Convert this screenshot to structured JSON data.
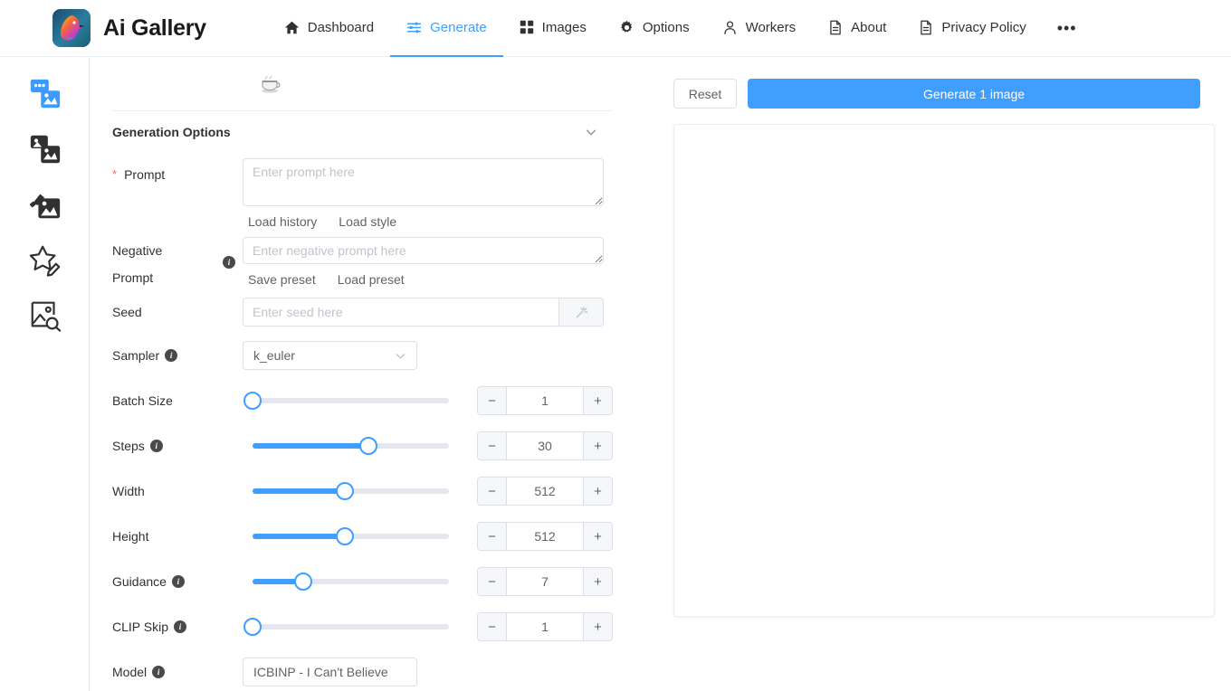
{
  "header": {
    "brand": "Ai Gallery",
    "logo_icon": "bird-logo",
    "nav": [
      {
        "label": "Dashboard",
        "icon": "home-icon",
        "active": false
      },
      {
        "label": "Generate",
        "icon": "sliders-icon",
        "active": true
      },
      {
        "label": "Images",
        "icon": "grid-icon",
        "active": false
      },
      {
        "label": "Options",
        "icon": "gear-icon",
        "active": false
      },
      {
        "label": "Workers",
        "icon": "user-icon",
        "active": false
      },
      {
        "label": "About",
        "icon": "document-icon",
        "active": false
      },
      {
        "label": "Privacy Policy",
        "icon": "document-icon",
        "active": false
      }
    ],
    "more_label": "•••"
  },
  "sidebar": {
    "items": [
      {
        "name": "text-to-image",
        "icon": "chat-image-icon",
        "active": true
      },
      {
        "name": "image-to-image",
        "icon": "images-icon",
        "active": false
      },
      {
        "name": "inpainting",
        "icon": "brush-image-icon",
        "active": false
      },
      {
        "name": "rating",
        "icon": "star-pencil-icon",
        "active": false
      },
      {
        "name": "interrogate",
        "icon": "image-search-icon",
        "active": false
      }
    ]
  },
  "form": {
    "coffee_icon": "coffee-cup-icon",
    "section_title": "Generation Options",
    "collapse_icon": "chevron-down-icon",
    "prompt": {
      "label": "Prompt",
      "required_marker": "*",
      "value": "",
      "placeholder": "Enter prompt here",
      "links": [
        "Load history",
        "Load style"
      ]
    },
    "negative_prompt": {
      "label_line1": "Negative",
      "label_line2": "Prompt",
      "info_icon": "info-icon",
      "value": "",
      "placeholder": "Enter negative prompt here",
      "links": [
        "Save preset",
        "Load preset"
      ]
    },
    "seed": {
      "label": "Seed",
      "value": "",
      "placeholder": "Enter seed here",
      "random_icon": "magic-wand-icon"
    },
    "sampler": {
      "label": "Sampler",
      "info_icon": "info-icon",
      "value": "k_euler",
      "chevron": "chevron-down-icon"
    },
    "sliders": [
      {
        "label": "Batch Size",
        "info": false,
        "value": "1",
        "percent": 0
      },
      {
        "label": "Steps",
        "info": true,
        "value": "30",
        "percent": 59
      },
      {
        "label": "Width",
        "info": false,
        "value": "512",
        "percent": 47
      },
      {
        "label": "Height",
        "info": false,
        "value": "512",
        "percent": 47
      },
      {
        "label": "Guidance",
        "info": true,
        "value": "7",
        "percent": 26
      },
      {
        "label": "CLIP Skip",
        "info": true,
        "value": "1",
        "percent": 0
      }
    ],
    "stepper_minus": "−",
    "stepper_plus": "+",
    "model": {
      "label": "Model",
      "info_icon": "info-icon",
      "value": "ICBINP - I Can't Believe"
    }
  },
  "actions": {
    "reset_label": "Reset",
    "generate_label": "Generate 1 image"
  },
  "colors": {
    "primary": "#409eff",
    "border": "#dcdfe6",
    "text": "#303133",
    "placeholder": "#c0c4cc",
    "required": "#f56c6c"
  }
}
